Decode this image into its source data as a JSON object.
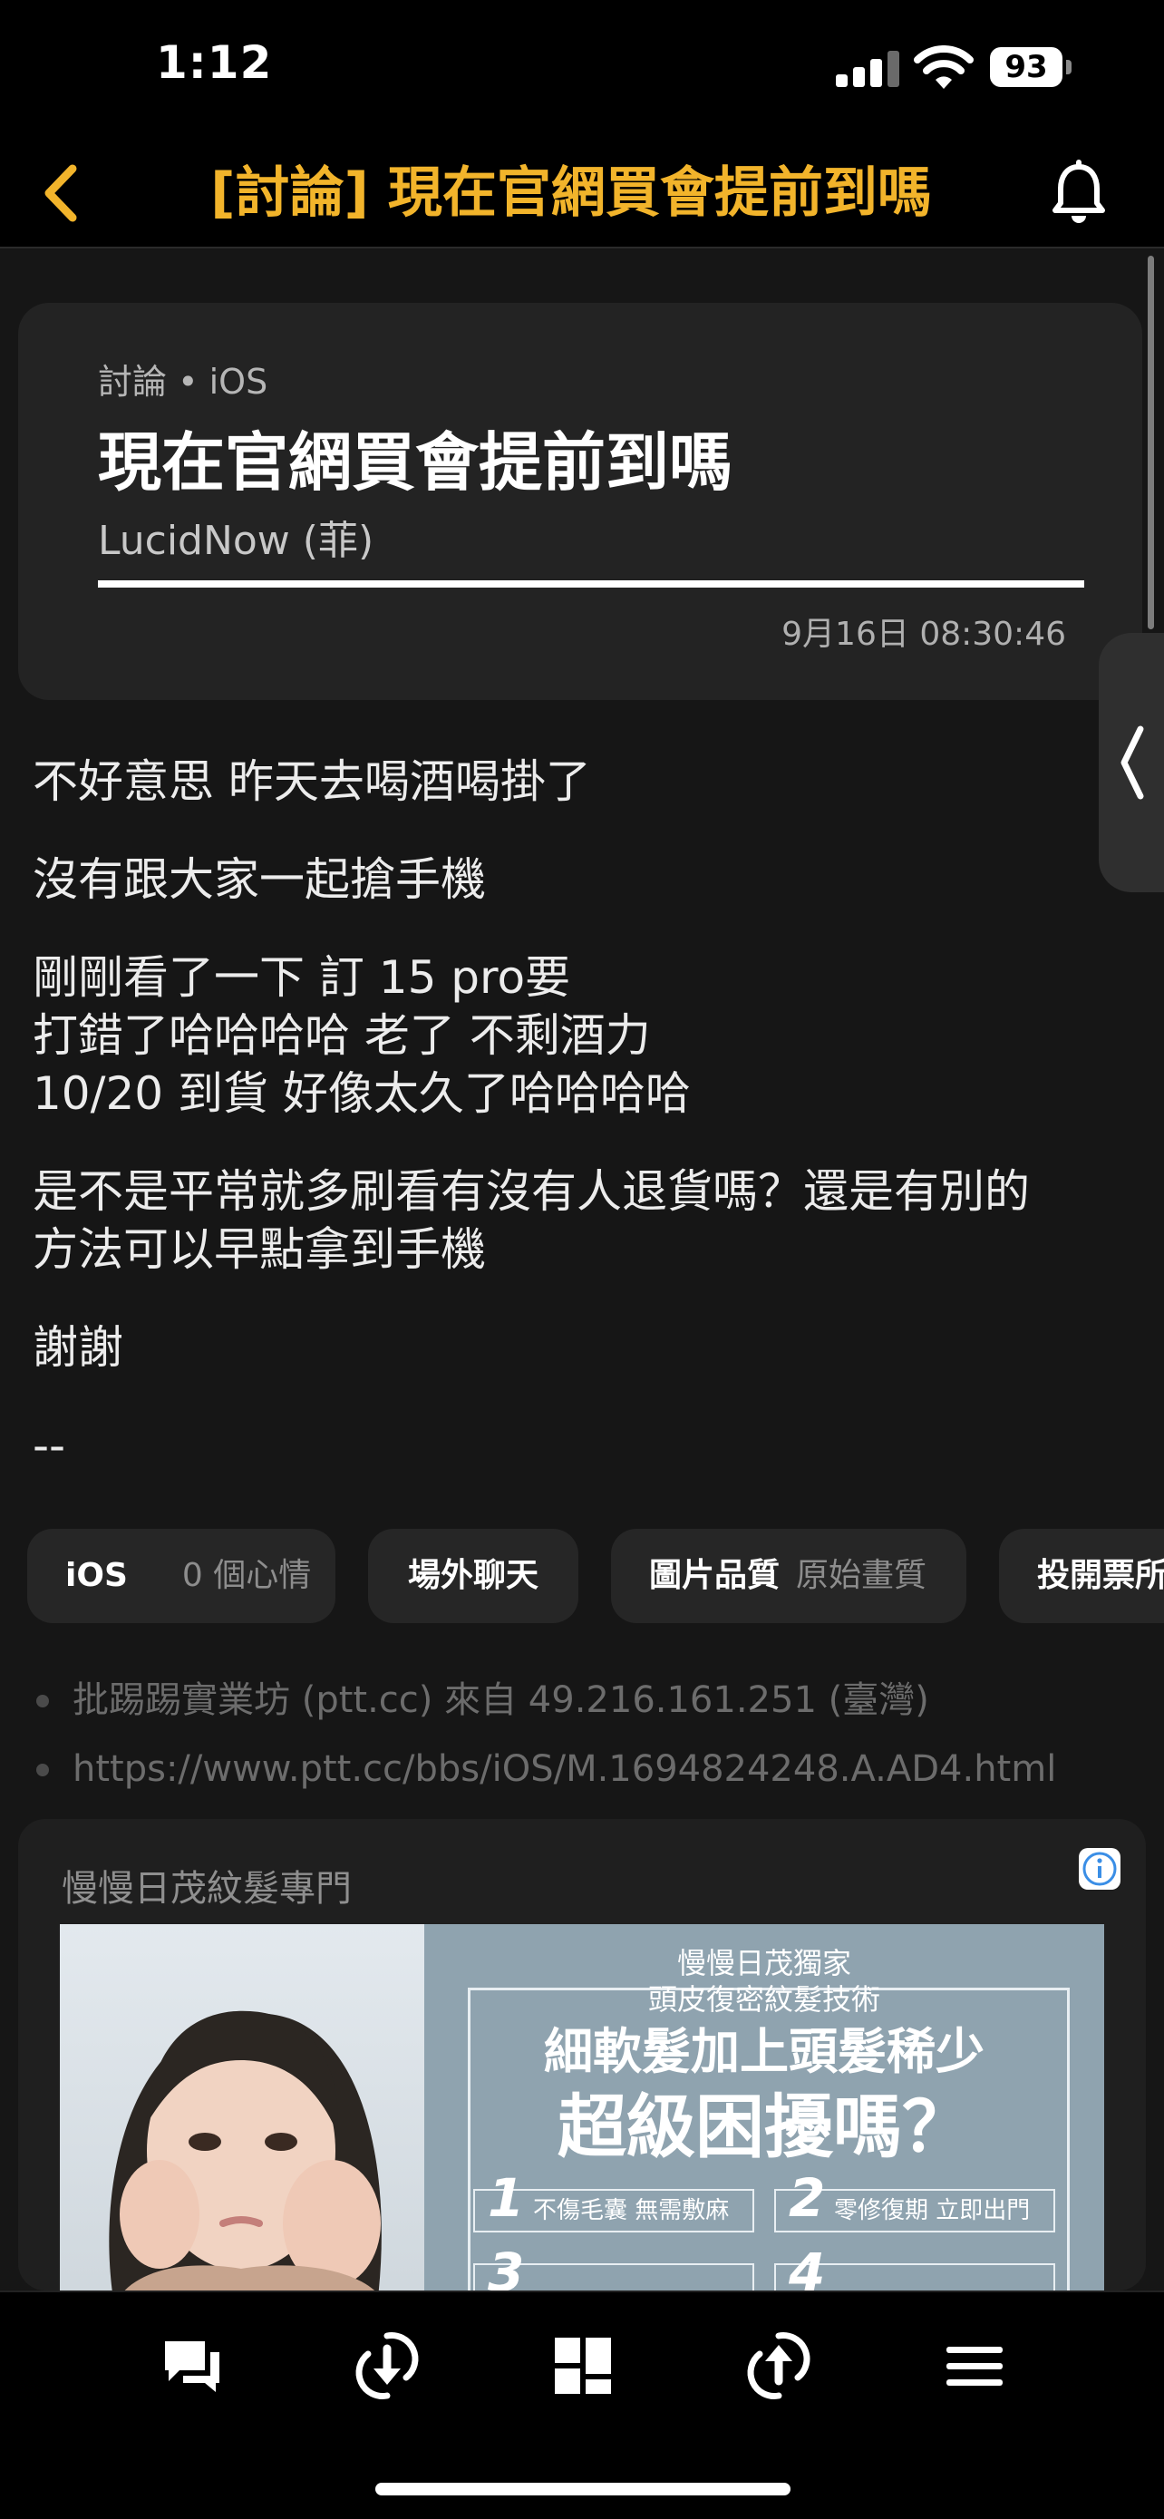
{
  "status_bar": {
    "time": "1:12",
    "battery": "93"
  },
  "header": {
    "title": "[討論] 現在官網買會提前到嗎"
  },
  "post": {
    "board_tag": "討論",
    "board_name": "iOS",
    "title": "現在官網買會提前到嗎",
    "author": "LucidNow (菲)",
    "timestamp": "9月16日 08:30:46",
    "body": [
      "不好意思 昨天去喝酒喝掛了",
      "沒有跟大家一起搶手機",
      "剛剛看了一下 訂 15 pro要",
      "打錯了哈哈哈哈 老了 不剩酒力",
      "10/20 到貨 好像太久了哈哈哈哈",
      "是不是平常就多刷看有沒有人退貨嗎？還是有別的",
      "方法可以早點拿到手機",
      "謝謝",
      "--"
    ]
  },
  "chips": [
    {
      "label": "iOS",
      "sub": "0 個心情"
    },
    {
      "label": "場外聊天",
      "sub": ""
    },
    {
      "label": "圖片品質",
      "sub": "原始畫質"
    },
    {
      "label": "投開票所",
      "sub": ""
    }
  ],
  "info": [
    "批踢踢實業坊 (ptt.cc) 來自 49.216.161.251 (臺灣)",
    "https://www.ptt.cc/bbs/iOS/M.1694824248.A.AD4.html"
  ],
  "ad": {
    "label": "慢慢日茂紋髮專門",
    "line1": "慢慢日茂獨家",
    "line2": "頭皮復密紋髮技術",
    "line3": "細軟髮加上頭髮稀少",
    "line4": "超級困擾嗎？",
    "feature1_num": "1",
    "feature1": "不傷毛囊 無需敷麻",
    "feature2_num": "2",
    "feature2": "零修復期 立即出門",
    "feature3_num": "3",
    "feature4_num": "4"
  },
  "toolbar": [
    "comments-icon",
    "download-icon",
    "layout-icon",
    "refresh-icon",
    "menu-icon"
  ],
  "colors": {
    "accent": "#f2b42b",
    "background": "#161616",
    "card": "#232323"
  }
}
